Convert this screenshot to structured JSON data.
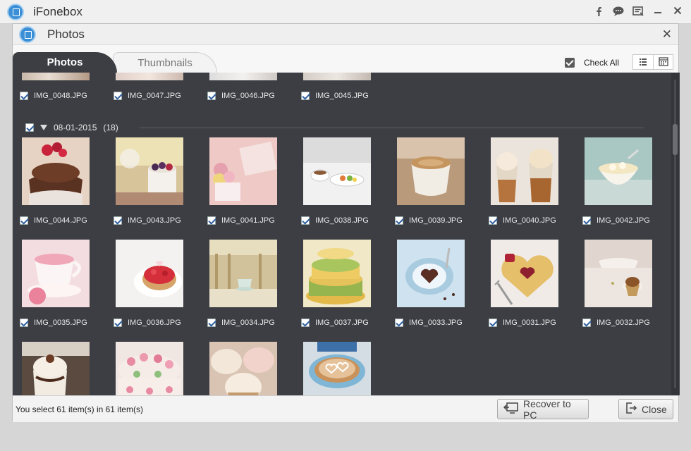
{
  "app": {
    "title": "iFonebox"
  },
  "dialog": {
    "title": "Photos"
  },
  "tabs": [
    {
      "label": "Photos"
    },
    {
      "label": "Thumbnails"
    }
  ],
  "check_all_label": "Check All",
  "group": {
    "date": "08-01-2015",
    "count": "(18)"
  },
  "top_row": [
    "IMG_0048.JPG",
    "IMG_0047.JPG",
    "IMG_0046.JPG",
    "IMG_0045.JPG"
  ],
  "row1": [
    "IMG_0044.JPG",
    "IMG_0043.JPG",
    "IMG_0041.JPG",
    "IMG_0038.JPG",
    "IMG_0039.JPG",
    "IMG_0040.JPG",
    "IMG_0042.JPG"
  ],
  "row2": [
    "IMG_0035.JPG",
    "IMG_0036.JPG",
    "IMG_0034.JPG",
    "IMG_0037.JPG",
    "IMG_0033.JPG",
    "IMG_0031.JPG",
    "IMG_0032.JPG"
  ],
  "status_text": "You select 61 item(s) in 61 item(s)",
  "buttons": {
    "recover": "Recover to PC",
    "close": "Close"
  },
  "colors": {
    "content_bg": "#3d3e44",
    "accent": "#3b8fd6"
  }
}
